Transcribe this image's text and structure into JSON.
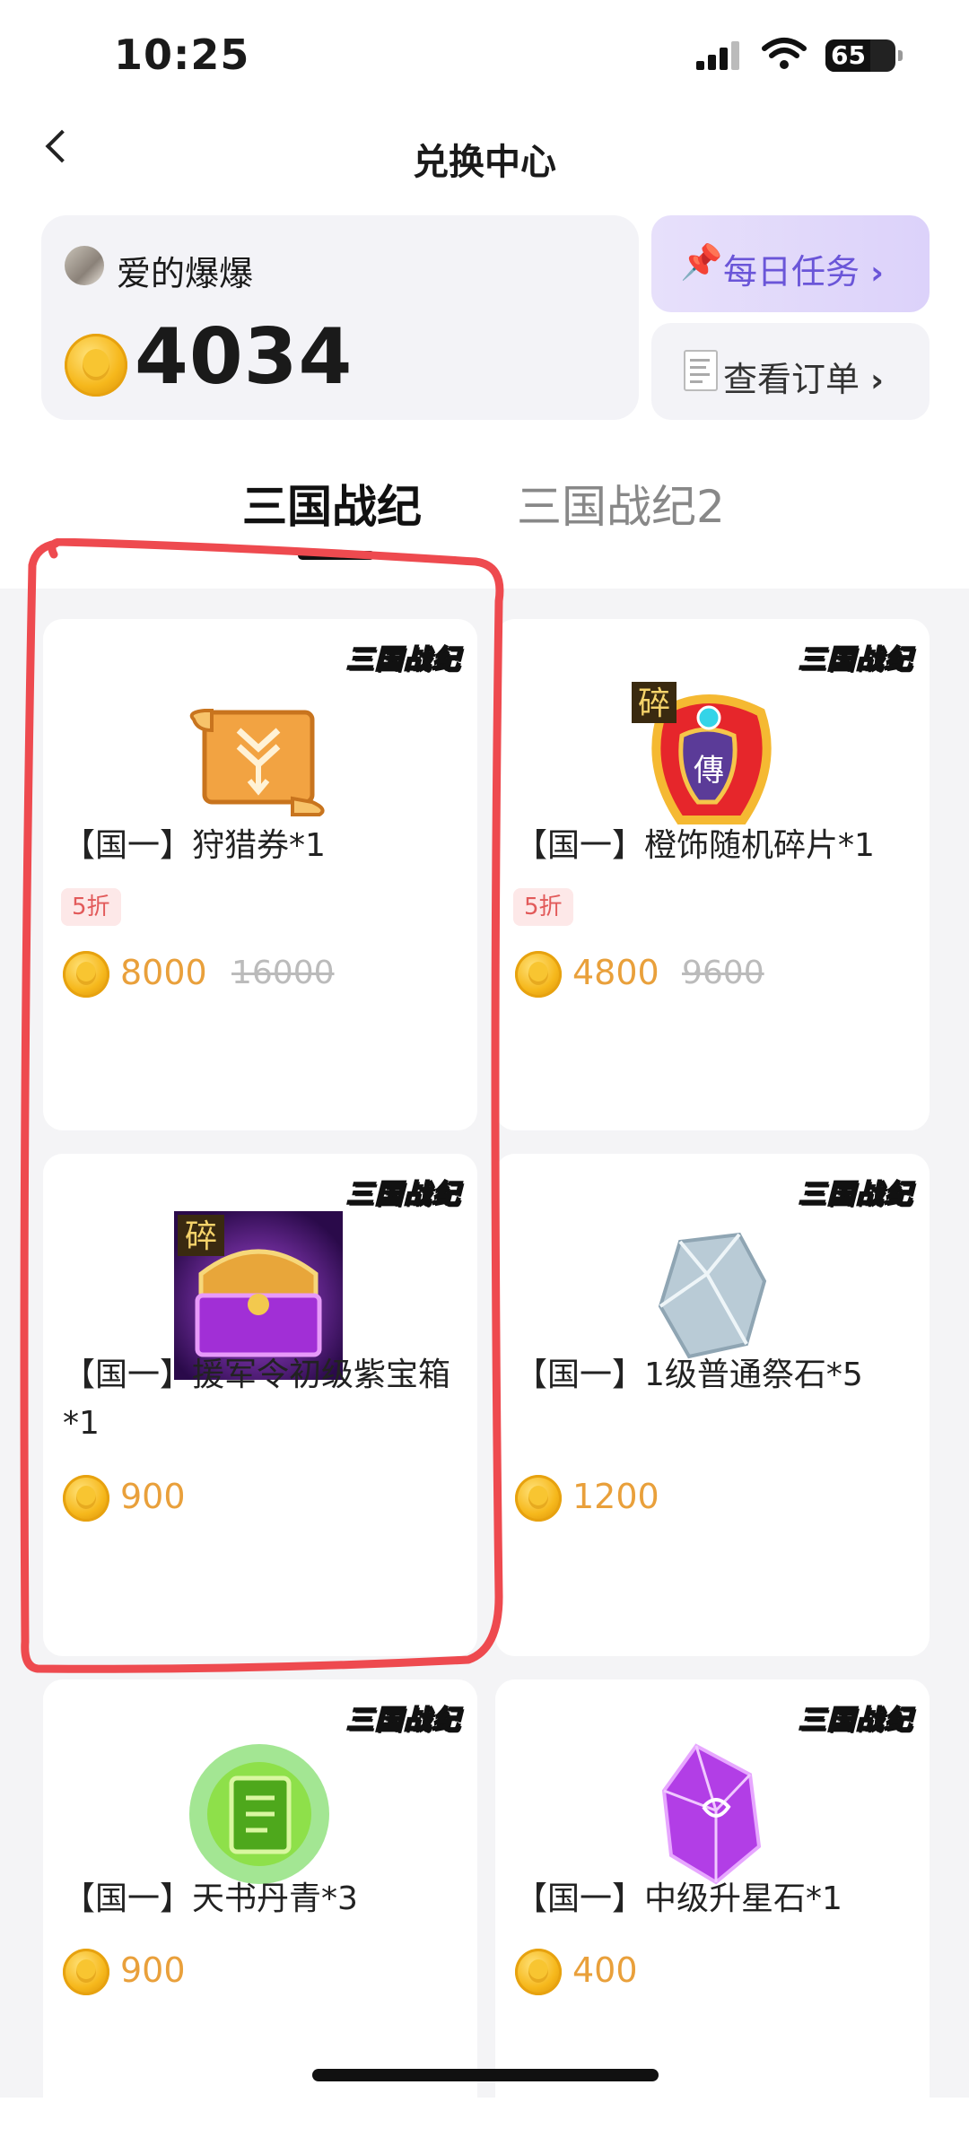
{
  "status_bar": {
    "time": "10:25",
    "battery": "65"
  },
  "nav": {
    "title": "兑换中心"
  },
  "user": {
    "name": "爱的爆爆",
    "points": "4034"
  },
  "side_buttons": {
    "daily_tasks": "每日任务",
    "view_orders": "查看订单"
  },
  "tabs": [
    {
      "label": "三国战纪",
      "active": true
    },
    {
      "label": "三国战纪2",
      "active": false
    }
  ],
  "brand_badge": "三国战纪",
  "products": [
    {
      "name": "【国一】狩猎券*1",
      "discount": "5折",
      "price": "8000",
      "original_price": "16000",
      "icon": "scroll-icon"
    },
    {
      "name": "【国一】橙饰随机碎片*1",
      "discount": "5折",
      "price": "4800",
      "original_price": "9600",
      "icon": "fragment-icon"
    },
    {
      "name": "【国一】援军令初级紫宝箱*1",
      "price": "900",
      "icon": "chest-icon"
    },
    {
      "name": "【国一】1级普通祭石*5",
      "price": "1200",
      "icon": "stone-icon"
    },
    {
      "name": "【国一】天书丹青*3",
      "price": "900",
      "icon": "book-icon"
    },
    {
      "name": "【国一】中级升星石*1",
      "price": "400",
      "icon": "star-stone-icon"
    }
  ],
  "colors": {
    "accent_purple": "#6a55d8",
    "price_orange": "#e9a03b",
    "highlight_red": "#ee4a4f",
    "discount_red": "#e25a5a"
  }
}
